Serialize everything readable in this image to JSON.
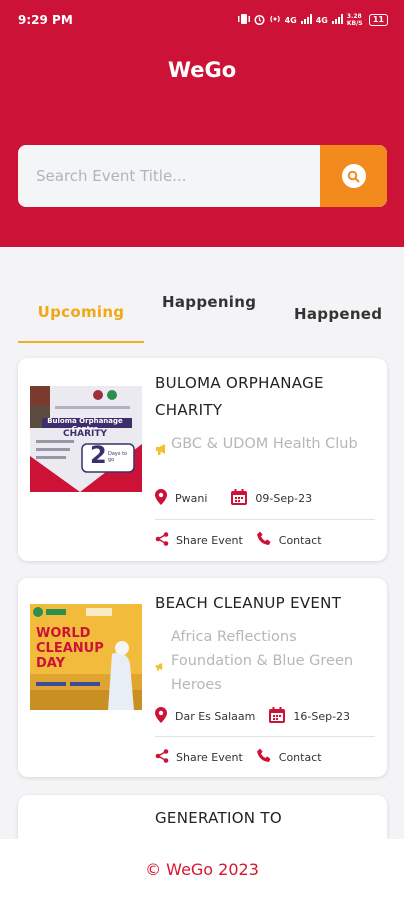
{
  "status_bar": {
    "time": "9:29 PM",
    "network_1": "4G",
    "network_2": "4G",
    "speed": "3.28 KB/S",
    "battery": "11"
  },
  "app": {
    "title": "WeGo"
  },
  "search": {
    "placeholder": "Search Event Title..."
  },
  "tabs": [
    {
      "label": "Upcoming",
      "active": true
    },
    {
      "label": "Happening",
      "active": false
    },
    {
      "label": "Happened",
      "active": false
    }
  ],
  "events": [
    {
      "title": "BULOMA ORPHANAGE CHARITY",
      "organizer": "GBC & UDOM Health Club",
      "location": "Pwani",
      "date": "09-Sep-23",
      "poster": {
        "subtitle": "Buloma Orphanage Centre",
        "heading": "CHARITY",
        "days": "2",
        "days_label": "Days to go"
      }
    },
    {
      "title": "BEACH CLEANUP EVENT",
      "organizer": "Africa Reflections Foundation & Blue Green Heroes",
      "location": "Dar Es Salaam",
      "date": "16-Sep-23",
      "poster": {
        "line1": "WORLD",
        "line2": "CLEANUP",
        "line3": "DAY"
      }
    },
    {
      "title": "GENERATION TO"
    }
  ],
  "actions": {
    "share": "Share Event",
    "contact": "Contact"
  },
  "footer": {
    "copyright": "© WeGo 2023"
  },
  "colors": {
    "brand_red": "#cc1236",
    "accent_orange": "#f28a1e",
    "tab_active": "#f0a814",
    "footer_text": "#d8162f"
  }
}
